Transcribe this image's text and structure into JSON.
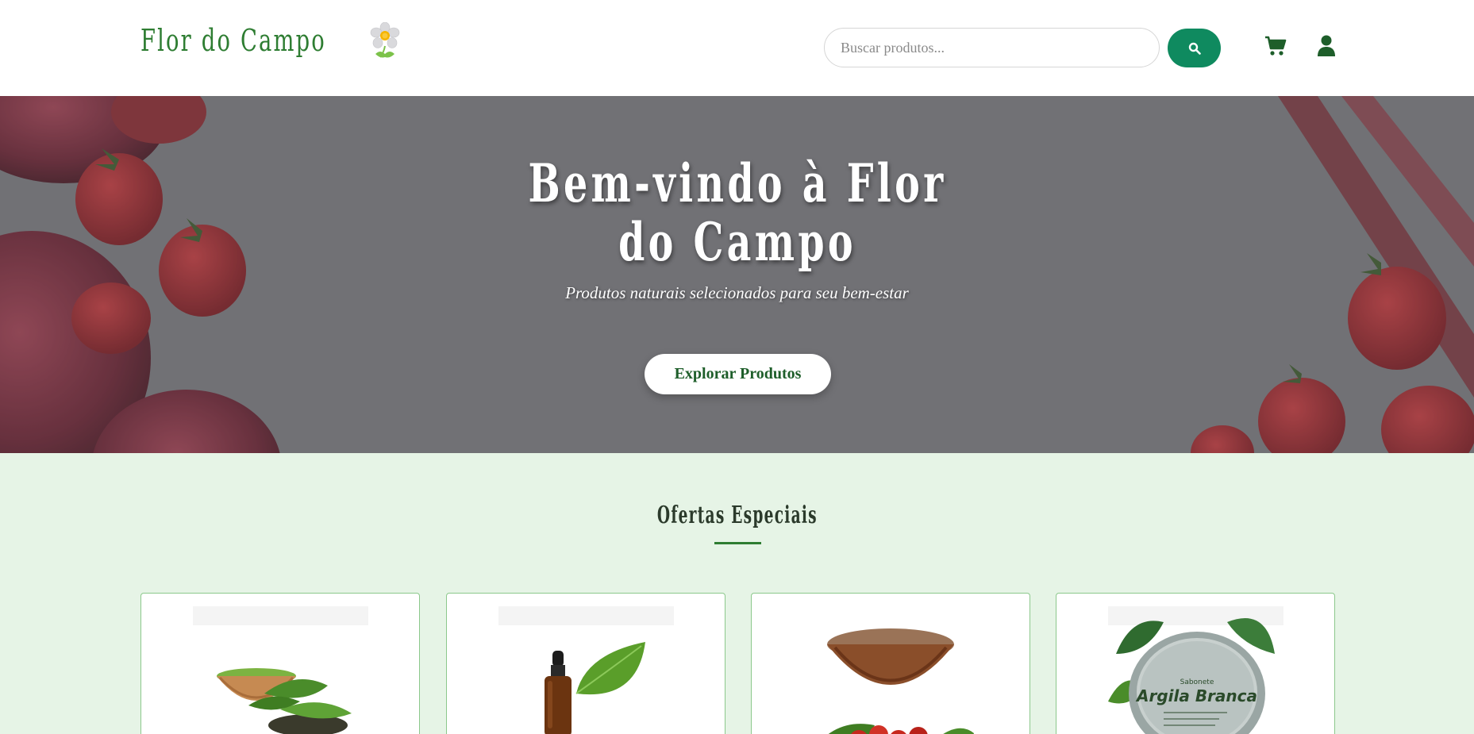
{
  "header": {
    "logo_text": "Flor do Campo",
    "logo_icon": "daisy-flower-icon",
    "search": {
      "placeholder": "Buscar produtos...",
      "value": ""
    },
    "search_icon": "search-icon",
    "cart_icon": "cart-icon",
    "user_icon": "user-icon"
  },
  "hero": {
    "title": "Bem-vindo à Flor do Campo",
    "subtitle": "Produtos naturais selecionados para seu bem-estar",
    "button_label": "Explorar Produtos"
  },
  "offers": {
    "title": "Ofertas Especiais",
    "products": [
      {
        "image": "matcha-green-tea-powder"
      },
      {
        "image": "essential-oil-dropper-bottle"
      },
      {
        "image": "guarana-powder-bowl"
      },
      {
        "image": "argila-branca-soap",
        "image_text": "Argila Branca"
      }
    ]
  },
  "colors": {
    "brand_green": "#2e7d32",
    "search_button": "#0f8a5f",
    "page_background": "#e6f4e6",
    "hero_overlay": "#76767a"
  }
}
